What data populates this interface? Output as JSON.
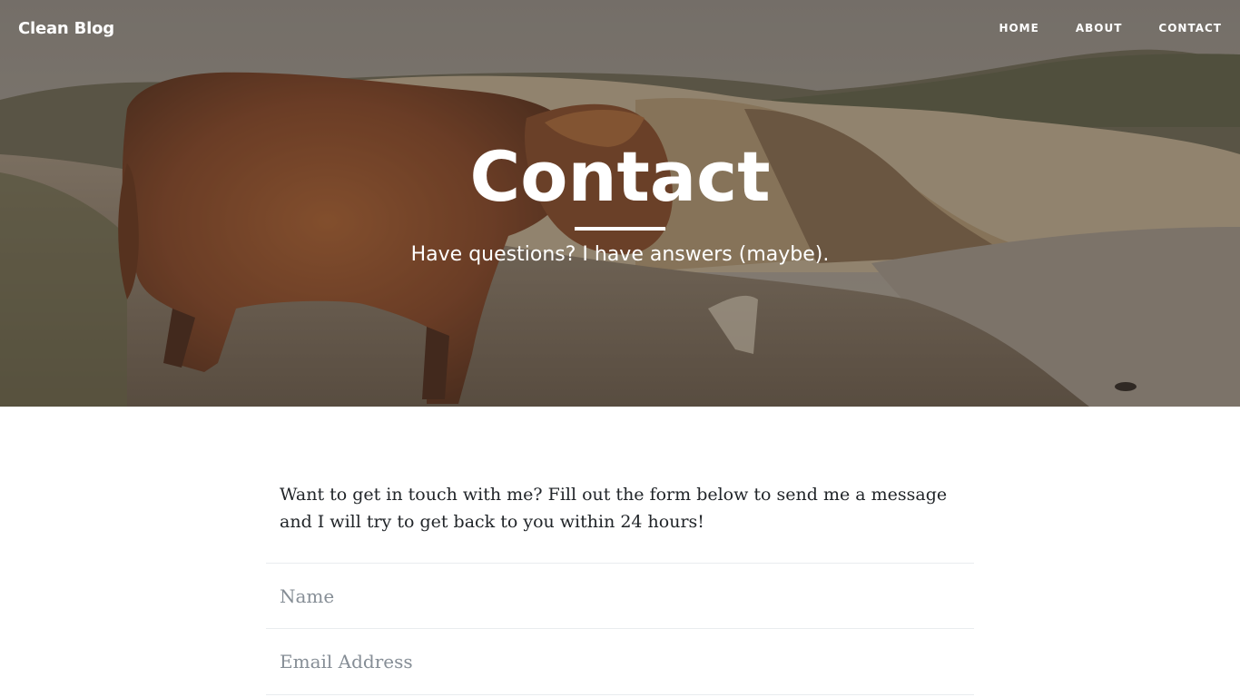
{
  "nav": {
    "brand": "Clean Blog",
    "links": [
      "HOME",
      "ABOUT",
      "CONTACT"
    ]
  },
  "hero": {
    "title": "Contact",
    "subtitle": "Have questions? I have answers (maybe)."
  },
  "main": {
    "intro": "Want to get in touch with me? Fill out the form below to send me a message and I will try to get back to you within 24 hours!",
    "form": {
      "name_placeholder": "Name",
      "email_placeholder": "Email Address"
    }
  },
  "colors": {
    "text": "#212529",
    "placeholder": "#868e96",
    "divider": "#e9ecef"
  }
}
